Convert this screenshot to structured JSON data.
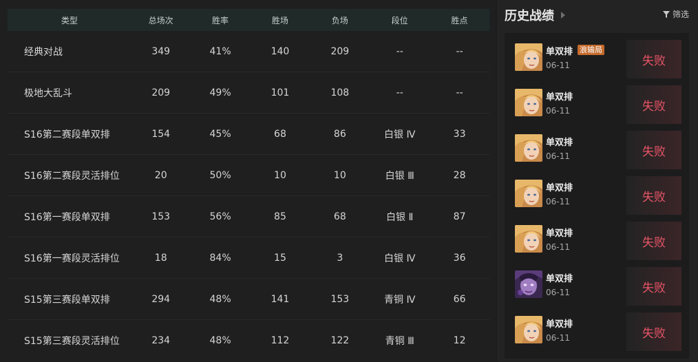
{
  "stats": {
    "headers": [
      "类型",
      "总场次",
      "胜率",
      "胜场",
      "负场",
      "段位",
      "胜点"
    ],
    "rows": [
      [
        "经典对战",
        "349",
        "41%",
        "140",
        "209",
        "--",
        "--"
      ],
      [
        "极地大乱斗",
        "209",
        "49%",
        "101",
        "108",
        "--",
        "--"
      ],
      [
        "S16第二赛段单双排",
        "154",
        "45%",
        "68",
        "86",
        "白银 Ⅳ",
        "33"
      ],
      [
        "S16第二赛段灵活排位",
        "20",
        "50%",
        "10",
        "10",
        "白银 Ⅲ",
        "28"
      ],
      [
        "S16第一赛段单双排",
        "153",
        "56%",
        "85",
        "68",
        "白银 Ⅱ",
        "87"
      ],
      [
        "S16第一赛段灵活排位",
        "18",
        "84%",
        "15",
        "3",
        "白银 Ⅳ",
        "36"
      ],
      [
        "S15第三赛段单双排",
        "294",
        "48%",
        "141",
        "153",
        "青铜 Ⅳ",
        "66"
      ],
      [
        "S15第三赛段灵活排位",
        "234",
        "48%",
        "112",
        "122",
        "青铜 Ⅲ",
        "12"
      ]
    ]
  },
  "history": {
    "title": "历史战绩",
    "filter_label": "筛选",
    "matches": [
      {
        "mode": "单双排",
        "tag": "浪输局",
        "date": "06-11",
        "result": "失败",
        "champion_icon": "blonde-champion-avatar"
      },
      {
        "mode": "单双排",
        "tag": "",
        "date": "06-11",
        "result": "失败",
        "champion_icon": "blonde-champion-avatar"
      },
      {
        "mode": "单双排",
        "tag": "",
        "date": "06-11",
        "result": "失败",
        "champion_icon": "blonde-champion-avatar"
      },
      {
        "mode": "单双排",
        "tag": "",
        "date": "06-11",
        "result": "失败",
        "champion_icon": "blonde-champion-avatar"
      },
      {
        "mode": "单双排",
        "tag": "",
        "date": "06-11",
        "result": "失败",
        "champion_icon": "blonde-champion-avatar"
      },
      {
        "mode": "单双排",
        "tag": "",
        "date": "06-11",
        "result": "失败",
        "champion_icon": "purple-champion-avatar"
      },
      {
        "mode": "单双排",
        "tag": "",
        "date": "06-11",
        "result": "失败",
        "champion_icon": "blonde-champion-avatar"
      }
    ]
  },
  "colors": {
    "loss": "#e85466",
    "tag": "#c46b2c",
    "header_bg": "#1f2a29"
  }
}
